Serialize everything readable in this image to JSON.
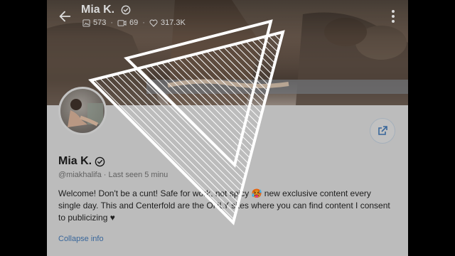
{
  "header": {
    "title": "Mia K.",
    "stats": {
      "photos": "573",
      "videos": "69",
      "likes": "317.3K"
    }
  },
  "profile": {
    "name": "Mia K.",
    "handle": "@miakhalifa",
    "last_seen": "Last seen 5 minu",
    "bio_text": "Welcome! Don't be a cunt! Safe for work, not spicy 🥵 new exclusive content every single day. This and Centerfold are the ONLY sites where you can find content I consent to publicizing ♥",
    "collapse_label": "Collapse info"
  },
  "icons": {
    "back": "arrow-left-icon",
    "verified": "verified-badge-icon",
    "photo": "image-icon",
    "video": "video-camera-icon",
    "like": "heart-icon",
    "more": "more-vertical-icon",
    "share": "share-icon",
    "overlay_logo": "play-triangle-logo"
  },
  "colors": {
    "accent": "#3d6fa8",
    "overlay_stroke": "#ffffff"
  }
}
